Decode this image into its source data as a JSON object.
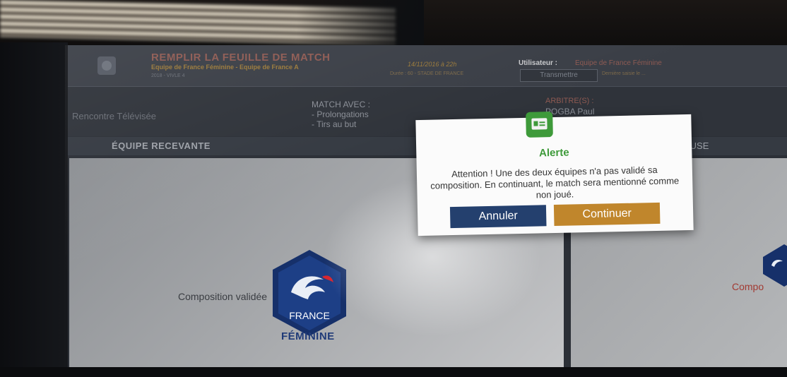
{
  "header": {
    "title": "REMPLIR LA FEUILLE DE MATCH",
    "match_teams": "Equipe de France Féminine - Equipe de France A",
    "match_sub": "2018 - VIVLE 4",
    "datetime": "14/11/2016 à 22h",
    "venue": "Durée : 60 - STADE DE FRANCE",
    "user_label": "Utilisateur :",
    "user_value": "Equipe de France Féminine",
    "transmit_label": "Transmettre",
    "transmit_note": "Dernière saisie le ..."
  },
  "info": {
    "televisee": "Rencontre Télévisée",
    "match_avec_title": "MATCH AVEC :",
    "match_avec_items": [
      "- Prolongations",
      "- Tirs au but"
    ],
    "arbitre_label": "ARBITRE(S) :",
    "arbitre_name": "POGBA Paul"
  },
  "teams": {
    "home_header": "ÉQUIPE RECEVANTE",
    "away_header": "EUSE",
    "home_status": "Composition validée",
    "away_status": "Compo",
    "home_crest_text": "FRANCE",
    "home_crest_caption": "FÉMININE"
  },
  "alert": {
    "title": "Alerte",
    "message": "Attention ! Une des deux équipes n'a pas validé sa composition. En continuant, le match sera mentionné comme non joué.",
    "cancel_label": "Annuler",
    "continue_label": "Continuer",
    "accent_color": "#3e9a3a",
    "cancel_color": "#24406e",
    "continue_color": "#c0862c",
    "badge_icon": "id-card-icon"
  }
}
